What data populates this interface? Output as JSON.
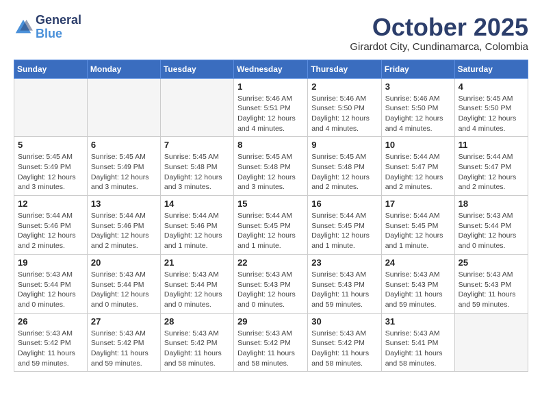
{
  "header": {
    "logo_general": "General",
    "logo_blue": "Blue",
    "month_title": "October 2025",
    "location": "Girardot City, Cundinamarca, Colombia"
  },
  "weekdays": [
    "Sunday",
    "Monday",
    "Tuesday",
    "Wednesday",
    "Thursday",
    "Friday",
    "Saturday"
  ],
  "weeks": [
    [
      {
        "day": "",
        "info": ""
      },
      {
        "day": "",
        "info": ""
      },
      {
        "day": "",
        "info": ""
      },
      {
        "day": "1",
        "info": "Sunrise: 5:46 AM\nSunset: 5:51 PM\nDaylight: 12 hours\nand 4 minutes."
      },
      {
        "day": "2",
        "info": "Sunrise: 5:46 AM\nSunset: 5:50 PM\nDaylight: 12 hours\nand 4 minutes."
      },
      {
        "day": "3",
        "info": "Sunrise: 5:46 AM\nSunset: 5:50 PM\nDaylight: 12 hours\nand 4 minutes."
      },
      {
        "day": "4",
        "info": "Sunrise: 5:45 AM\nSunset: 5:50 PM\nDaylight: 12 hours\nand 4 minutes."
      }
    ],
    [
      {
        "day": "5",
        "info": "Sunrise: 5:45 AM\nSunset: 5:49 PM\nDaylight: 12 hours\nand 3 minutes."
      },
      {
        "day": "6",
        "info": "Sunrise: 5:45 AM\nSunset: 5:49 PM\nDaylight: 12 hours\nand 3 minutes."
      },
      {
        "day": "7",
        "info": "Sunrise: 5:45 AM\nSunset: 5:48 PM\nDaylight: 12 hours\nand 3 minutes."
      },
      {
        "day": "8",
        "info": "Sunrise: 5:45 AM\nSunset: 5:48 PM\nDaylight: 12 hours\nand 3 minutes."
      },
      {
        "day": "9",
        "info": "Sunrise: 5:45 AM\nSunset: 5:48 PM\nDaylight: 12 hours\nand 2 minutes."
      },
      {
        "day": "10",
        "info": "Sunrise: 5:44 AM\nSunset: 5:47 PM\nDaylight: 12 hours\nand 2 minutes."
      },
      {
        "day": "11",
        "info": "Sunrise: 5:44 AM\nSunset: 5:47 PM\nDaylight: 12 hours\nand 2 minutes."
      }
    ],
    [
      {
        "day": "12",
        "info": "Sunrise: 5:44 AM\nSunset: 5:46 PM\nDaylight: 12 hours\nand 2 minutes."
      },
      {
        "day": "13",
        "info": "Sunrise: 5:44 AM\nSunset: 5:46 PM\nDaylight: 12 hours\nand 2 minutes."
      },
      {
        "day": "14",
        "info": "Sunrise: 5:44 AM\nSunset: 5:46 PM\nDaylight: 12 hours\nand 1 minute."
      },
      {
        "day": "15",
        "info": "Sunrise: 5:44 AM\nSunset: 5:45 PM\nDaylight: 12 hours\nand 1 minute."
      },
      {
        "day": "16",
        "info": "Sunrise: 5:44 AM\nSunset: 5:45 PM\nDaylight: 12 hours\nand 1 minute."
      },
      {
        "day": "17",
        "info": "Sunrise: 5:44 AM\nSunset: 5:45 PM\nDaylight: 12 hours\nand 1 minute."
      },
      {
        "day": "18",
        "info": "Sunrise: 5:43 AM\nSunset: 5:44 PM\nDaylight: 12 hours\nand 0 minutes."
      }
    ],
    [
      {
        "day": "19",
        "info": "Sunrise: 5:43 AM\nSunset: 5:44 PM\nDaylight: 12 hours\nand 0 minutes."
      },
      {
        "day": "20",
        "info": "Sunrise: 5:43 AM\nSunset: 5:44 PM\nDaylight: 12 hours\nand 0 minutes."
      },
      {
        "day": "21",
        "info": "Sunrise: 5:43 AM\nSunset: 5:44 PM\nDaylight: 12 hours\nand 0 minutes."
      },
      {
        "day": "22",
        "info": "Sunrise: 5:43 AM\nSunset: 5:43 PM\nDaylight: 12 hours\nand 0 minutes."
      },
      {
        "day": "23",
        "info": "Sunrise: 5:43 AM\nSunset: 5:43 PM\nDaylight: 11 hours\nand 59 minutes."
      },
      {
        "day": "24",
        "info": "Sunrise: 5:43 AM\nSunset: 5:43 PM\nDaylight: 11 hours\nand 59 minutes."
      },
      {
        "day": "25",
        "info": "Sunrise: 5:43 AM\nSunset: 5:43 PM\nDaylight: 11 hours\nand 59 minutes."
      }
    ],
    [
      {
        "day": "26",
        "info": "Sunrise: 5:43 AM\nSunset: 5:42 PM\nDaylight: 11 hours\nand 59 minutes."
      },
      {
        "day": "27",
        "info": "Sunrise: 5:43 AM\nSunset: 5:42 PM\nDaylight: 11 hours\nand 59 minutes."
      },
      {
        "day": "28",
        "info": "Sunrise: 5:43 AM\nSunset: 5:42 PM\nDaylight: 11 hours\nand 58 minutes."
      },
      {
        "day": "29",
        "info": "Sunrise: 5:43 AM\nSunset: 5:42 PM\nDaylight: 11 hours\nand 58 minutes."
      },
      {
        "day": "30",
        "info": "Sunrise: 5:43 AM\nSunset: 5:42 PM\nDaylight: 11 hours\nand 58 minutes."
      },
      {
        "day": "31",
        "info": "Sunrise: 5:43 AM\nSunset: 5:41 PM\nDaylight: 11 hours\nand 58 minutes."
      },
      {
        "day": "",
        "info": ""
      }
    ]
  ]
}
